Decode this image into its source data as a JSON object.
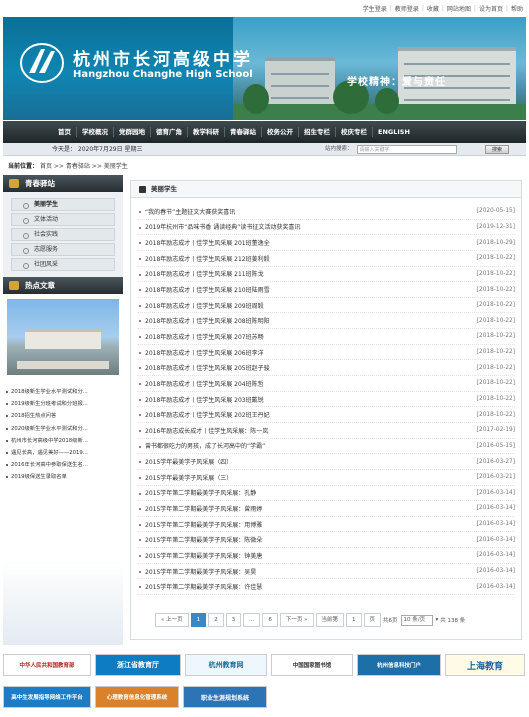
{
  "toplinks": [
    "学生登录",
    "教师登录",
    "收藏",
    "网站地图",
    "设为首页",
    "帮助"
  ],
  "header": {
    "cn_name": "杭州市长河高级中学",
    "en_name": "Hangzhou Changhe High School",
    "motto": "学校精神：爱与责任"
  },
  "nav": [
    "首页",
    "学校概况",
    "党群园地",
    "德育广角",
    "教学科研",
    "青春驿站",
    "校务公开",
    "招生专栏",
    "校庆专栏",
    "ENGLISH"
  ],
  "datebar": "今天是： 2020年7月29日 星期三",
  "search": {
    "label": "站内搜索：",
    "placeholder": "请输入关键字",
    "button": "搜索"
  },
  "breadcrumb": {
    "label": "当前位置：",
    "items": [
      "首页",
      ">>",
      "青春驿站",
      ">>",
      "美丽学生"
    ]
  },
  "sidebar": {
    "title": "青春驿站",
    "items": [
      "美丽学生",
      "文体活动",
      "社会实践",
      "志愿服务",
      "社团风采"
    ],
    "active": 0
  },
  "hot": {
    "title": "热点文章",
    "items": [
      "2018级新生学业水平测试和分...",
      "2019级新生分班考试和分班报...",
      "2018招生热点问答",
      "2020级新生学业水平测试和分...",
      "杭州市长河高级中学2018级新...",
      "遇见长高，遇见美好——2019...",
      "2016年长河高中参取保送生名...",
      "2019级保送生录取名单"
    ]
  },
  "main": {
    "title": "美丽学生",
    "rows": [
      {
        "t": "“我的春节”主题征文大赛获奖喜讯",
        "d": "[2020-05-15]"
      },
      {
        "t": "2019年杭州市“品味书香 诵读经典”读书征文活动获奖喜讯",
        "d": "[2019-12-31]"
      },
      {
        "t": "2018年励志成才丨佳学生风采展 201班董逸全",
        "d": "[2018-10-29]"
      },
      {
        "t": "2018年励志成才丨佳学生风采展 212班姜利毅",
        "d": "[2018-10-22]"
      },
      {
        "t": "2018年励志成才丨佳学生风采展 211班陈戈",
        "d": "[2018-10-22]"
      },
      {
        "t": "2018年励志成才丨佳学生风采展 210班陆雨雪",
        "d": "[2018-10-22]"
      },
      {
        "t": "2018年励志成才丨佳学生风采展 209班周毅",
        "d": "[2018-10-22]"
      },
      {
        "t": "2018年励志成才丨佳学生风采展 208班陈明阳",
        "d": "[2018-10-22]"
      },
      {
        "t": "2018年励志成才丨佳学生风采展 207班苏畅",
        "d": "[2018-10-22]"
      },
      {
        "t": "2018年励志成才丨佳学生风采展 206班李洋",
        "d": "[2018-10-22]"
      },
      {
        "t": "2018年励志成才丨佳学生风采展 205班赵子骏",
        "d": "[2018-10-22]"
      },
      {
        "t": "2018年励志成才丨佳学生风采展 204班陈哲",
        "d": "[2018-10-22]"
      },
      {
        "t": "2018年励志成才丨佳学生风采展 203班戴锐",
        "d": "[2018-10-22]"
      },
      {
        "t": "2018年励志成才丨佳学生风采展 202班王丹妃",
        "d": "[2018-10-22]"
      },
      {
        "t": "2016年励志成长成才丨佳学生风采展：陈一岚",
        "d": "[2017-02-19]"
      },
      {
        "t": "曾书都很吃力的男孩，成了长河高中的“学霸”",
        "d": "[2016-05-15]"
      },
      {
        "t": "2015学年最美学子风采展（四）",
        "d": "[2016-03-27]"
      },
      {
        "t": "2015学年最美学子风采展（三）",
        "d": "[2016-03-21]"
      },
      {
        "t": "2015学年第二学期最美学子风采展：孔静",
        "d": "[2016-03-14]"
      },
      {
        "t": "2015学年第二学期最美学子风采展：曾雨婷",
        "d": "[2016-03-14]"
      },
      {
        "t": "2015学年第二学期最美学子风采展：用博雅",
        "d": "[2016-03-14]"
      },
      {
        "t": "2015学年第二学期最美学子风采展：陈微朵",
        "d": "[2016-03-14]"
      },
      {
        "t": "2015学年第二学期最美学子风采展：钟美唐",
        "d": "[2016-03-14]"
      },
      {
        "t": "2015学年第二学期最美学子风采展：吴昊",
        "d": "[2016-03-14]"
      },
      {
        "t": "2015学年第二学期最美学子风采展：许佳慧",
        "d": "[2016-03-14]"
      }
    ]
  },
  "pager": {
    "prev": "« 上一页",
    "pages": [
      "1",
      "2",
      "3",
      "...",
      "6"
    ],
    "next": "下一页 »",
    "goto_pre": "当前第",
    "page_val": "1",
    "goto_post": "页",
    "total_pages": "共6页",
    "per_page": "10 条/页",
    "total": "共 138 条"
  },
  "links": [
    "中华人民共和国教育部",
    "浙江省教育厅",
    "杭州教育网",
    "中国国家图书馆",
    "杭州信息科技门户",
    "上海教育",
    "高中生发展指导网络工作平台",
    "心理教育信息化管理系统",
    "职业生涯规划系统"
  ],
  "colors": {
    "nav_bg": "#2a3337",
    "accent": "#3c88c6",
    "banner": "#0f86b2"
  }
}
